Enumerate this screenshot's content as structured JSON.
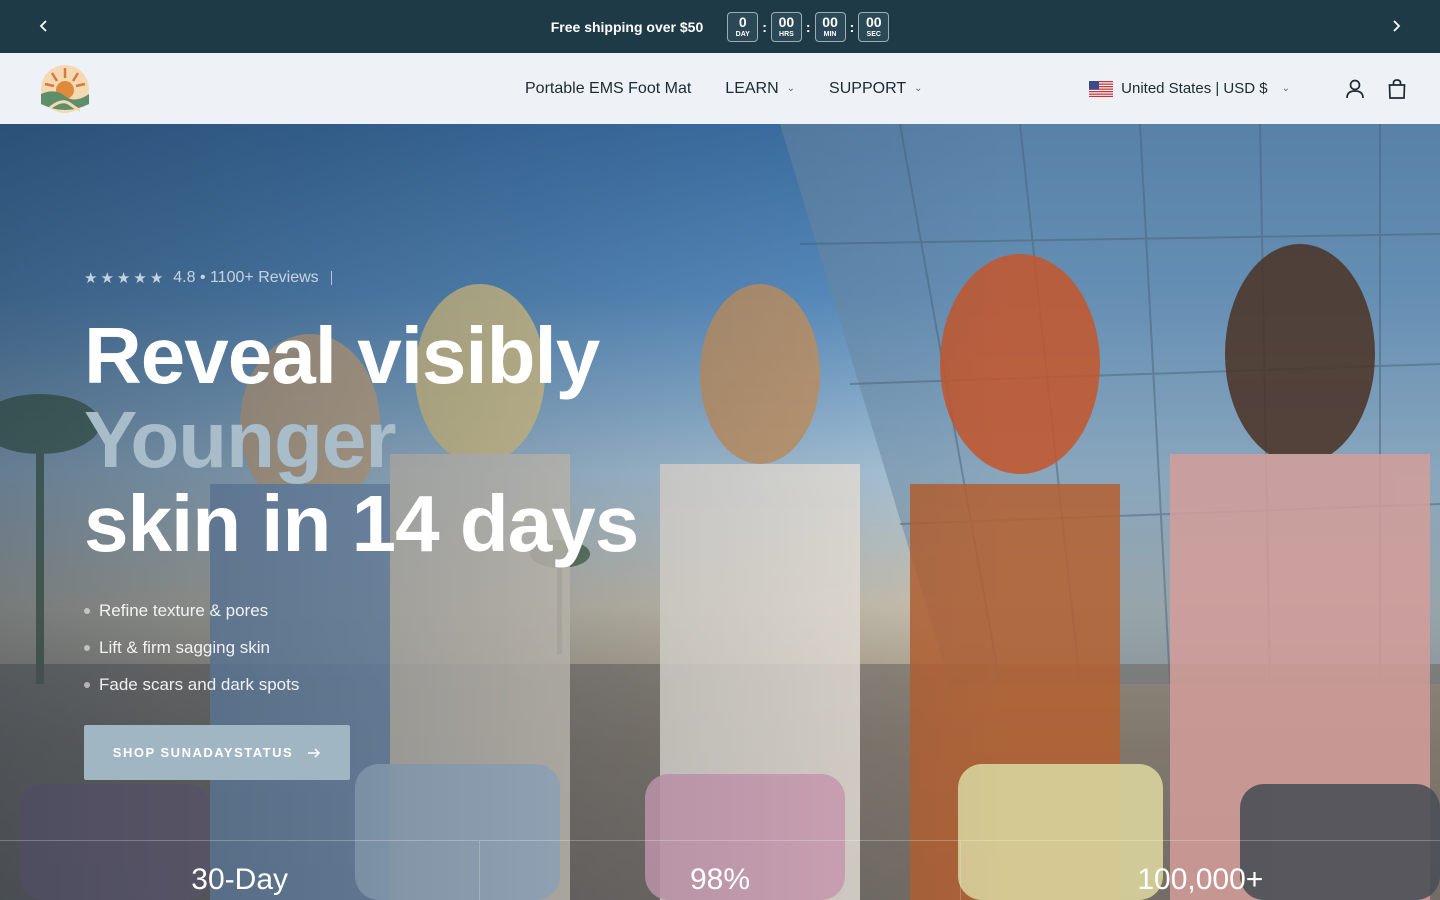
{
  "announcement": {
    "message": "Free shipping over $50",
    "countdown": [
      {
        "value": "0",
        "label": "DAY"
      },
      {
        "value": "00",
        "label": "HRS"
      },
      {
        "value": "00",
        "label": "MIN"
      },
      {
        "value": "00",
        "label": "SEC"
      }
    ]
  },
  "header": {
    "nav": [
      {
        "label": "Portable EMS Foot Mat",
        "dropdown": false
      },
      {
        "label": "LEARN",
        "dropdown": true
      },
      {
        "label": "SUPPORT",
        "dropdown": true
      }
    ],
    "country": "United States | USD $"
  },
  "hero": {
    "rating_text": "4.8 • 1100+ Reviews",
    "stars": 5,
    "headline_line1": "Reveal visibly",
    "headline_accent": "Younger",
    "headline_line3": "skin in 14 days",
    "bullets": [
      "Refine texture & pores",
      "Lift & firm sagging skin",
      "Fade scars and dark spots"
    ],
    "cta_label": "SHOP SUNADAYSTATUS"
  },
  "stats": [
    "30-Day",
    "98%",
    "100,000+"
  ],
  "colors": {
    "announcement_bg": "#1f3a47",
    "header_bg": "#eef2f7",
    "accent": "#a9bcc9",
    "cta_bg": "#a0b7c3"
  }
}
